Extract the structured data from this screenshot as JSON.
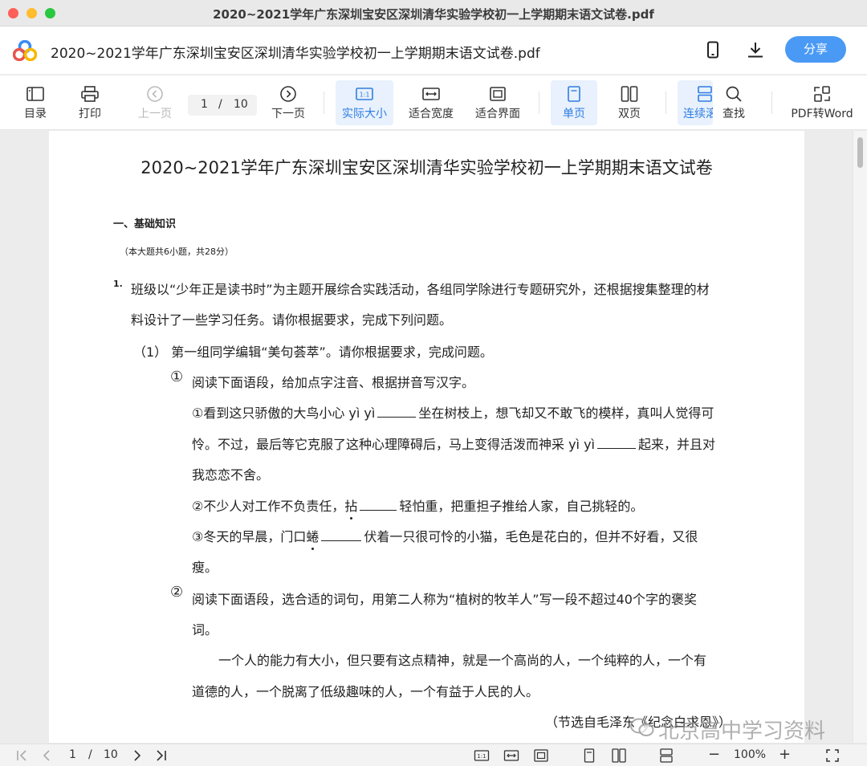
{
  "window": {
    "title": "2020~2021学年广东深圳宝安区深圳清华实验学校初一上学期期末语文试卷.pdf"
  },
  "header": {
    "doc_title": "2020~2021学年广东深圳宝安区深圳清华实验学校初一上学期期末语文试卷.pdf",
    "share_label": "分享",
    "share_color": "#4a9af5"
  },
  "toolbar": {
    "toc": "目录",
    "print": "打印",
    "prev": "上一页",
    "page_current": "1",
    "page_sep": "/",
    "page_total": "10",
    "next": "下一页",
    "actual_size": "实际大小",
    "fit_width": "适合宽度",
    "fit_page": "适合界面",
    "single": "单页",
    "double": "双页",
    "continuous": "连续滚",
    "find": "查找",
    "pdf_to_word": "PDF转Word",
    "accent": "#2f7de1"
  },
  "document": {
    "title": "2020~2021学年广东深圳宝安区深圳清华实验学校初一上学期期末语文试卷",
    "section": "一、基础知识",
    "section_note": "（本大题共6小题，共28分）",
    "q1_num": "1.",
    "q1_line1": "班级以“少年正是读书时”为主题开展综合实践活动，各组同学除进行专题研究外，还根据搜集整理的材",
    "q1_line2": "料设计了一些学习任务。请你根据要求，完成下列问题。",
    "sub1": "（1） 第一组同学编辑“美句荟萃”。请你根据要求，完成问题。",
    "item1_num": "①",
    "item1_text": "阅读下面语段，给加点字注音、根据拼音写汉字。",
    "s1_a": "①看到这只骄傲的大鸟小心 yì yì",
    "s1_b": "坐在树枝上，想飞却又不敢飞的模样，真叫人觉得可",
    "s1_c": "怜。不过，最后等它克服了这种心理障碍后，马上变得活泼而神采 yì yì",
    "s1_d": "起来，并且对",
    "s1_e": "我恋恋不舍。",
    "s2_a": "②不少人对工作不负责任，",
    "s2_char": "拈",
    "s2_b": "轻怕重，把重担子推给人家，自己挑轻的。",
    "s3_a": "③冬天的早晨，门口",
    "s3_char": "蜷",
    "s3_b": "伏着一只很可怜的小猫，毛色是花白的，但并不好看，又很",
    "s3_c": "瘦。",
    "item2_num": "②",
    "item2_line1": "阅读下面语段，选合适的词句，用第二人称为“植树的牧羊人”写一段不超过40个字的褒奖",
    "item2_line2": "词。",
    "quote_line1": "一个人的能力有大小，但只要有这点精神，就是一个高尚的人，一个纯粹的人，一个有",
    "quote_line2": "道德的人，一个脱离了低级趣味的人，一个有益于人民的人。",
    "source": "（节选自毛泽东《纪念白求恩》）"
  },
  "watermark": "北京高中学习资料",
  "bottombar": {
    "page_current": "1",
    "page_sep": "/",
    "page_total": "10",
    "zoom": "100%",
    "zoom_out": "−",
    "zoom_in": "+"
  }
}
